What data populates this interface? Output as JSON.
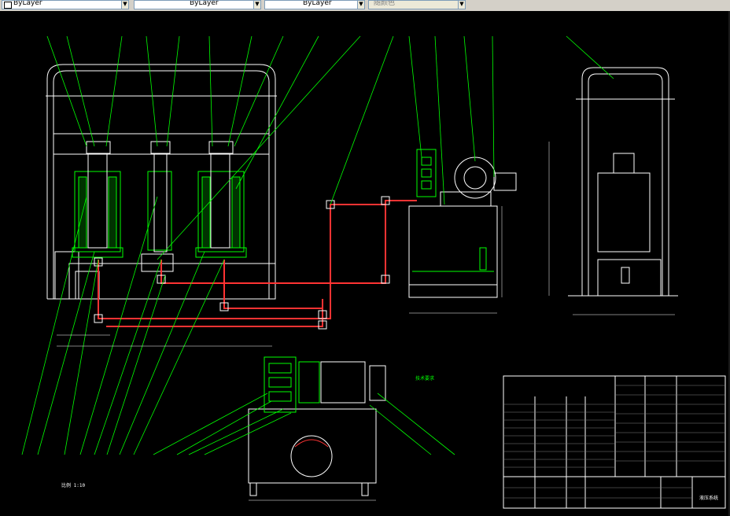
{
  "toolbar": {
    "layer_color_label": "ByLayer",
    "linetype_label": "ByLayer",
    "lineweight_label": "ByLayer",
    "plotstyle_label": "随颜色"
  },
  "drawing": {
    "colors": {
      "background": "#000000",
      "structure": "#ffffff",
      "leader": "#00ff00",
      "pipe": "#ff0000",
      "hatch": "#00cc00"
    },
    "title_block_name": "液压系统",
    "scale_note": "比例 1:10",
    "tech_req_title": "技术要求"
  }
}
